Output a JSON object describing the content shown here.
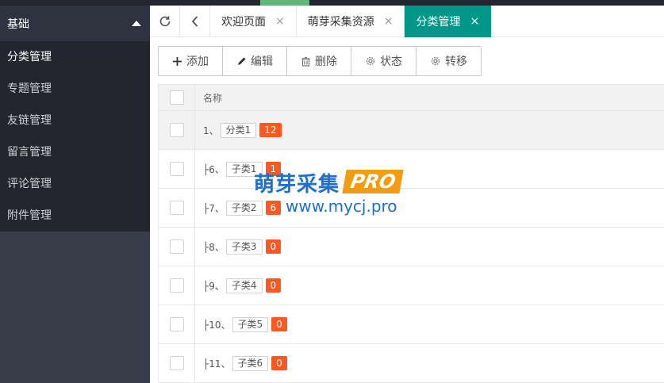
{
  "sidebar": {
    "header": "基础",
    "items": [
      {
        "label": "分类管理",
        "active": true
      },
      {
        "label": "专题管理"
      },
      {
        "label": "友链管理"
      },
      {
        "label": "留言管理"
      },
      {
        "label": "评论管理"
      },
      {
        "label": "附件管理"
      }
    ]
  },
  "tabs": [
    {
      "label": "欢迎页面",
      "close": "×"
    },
    {
      "label": "萌芽采集资源",
      "close": "×"
    },
    {
      "label": "分类管理",
      "close": "×",
      "active": true
    }
  ],
  "toolbar": {
    "add": "添加",
    "edit": "编辑",
    "delete": "删除",
    "status": "状态",
    "move": "转移"
  },
  "table": {
    "header_name": "名称",
    "rows": [
      {
        "prefix": "1、",
        "name": "分类1",
        "count": "12"
      },
      {
        "prefix": "├6、",
        "name": "子类1",
        "count": "1"
      },
      {
        "prefix": "├7、",
        "name": "子类2",
        "count": "6"
      },
      {
        "prefix": "├8、",
        "name": "子类3",
        "count": "0"
      },
      {
        "prefix": "├9、",
        "name": "子类4",
        "count": "0"
      },
      {
        "prefix": "├10、",
        "name": "子类5",
        "count": "0"
      },
      {
        "prefix": "├11、",
        "name": "子类6",
        "count": "0"
      }
    ]
  },
  "watermark": {
    "brand": "萌芽采集",
    "badge": "PRO",
    "url": "www.mycj.pro"
  },
  "colors": {
    "active_tab": "#009688",
    "count_badge": "#ff5722",
    "sidebar_bg": "#393d49"
  }
}
